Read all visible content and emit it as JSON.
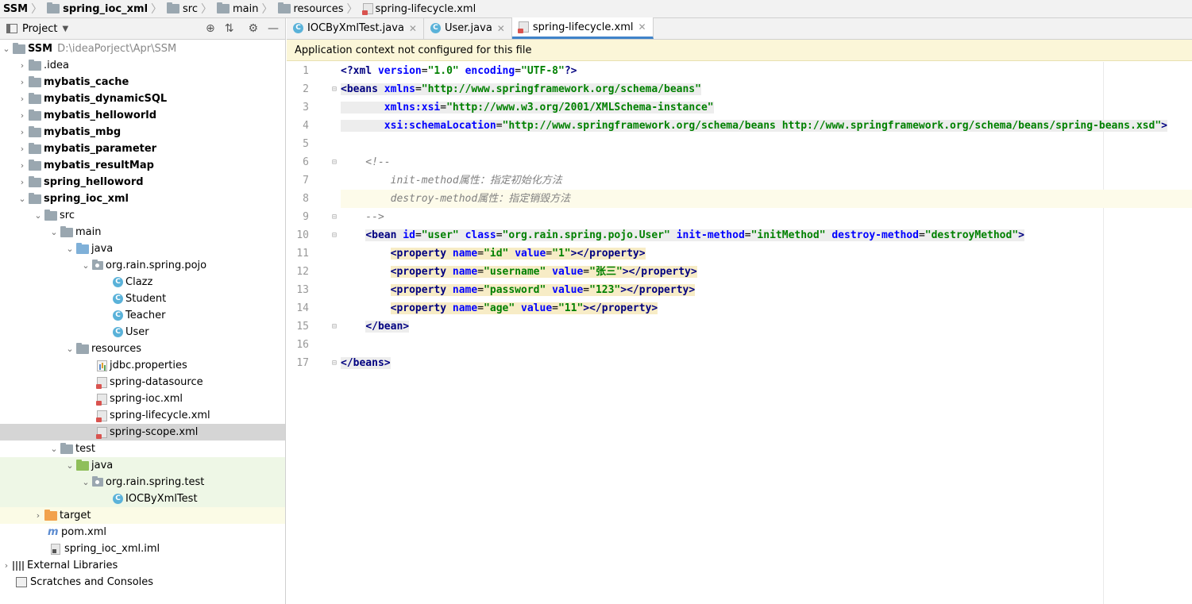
{
  "breadcrumb": [
    "SSM",
    "spring_ioc_xml",
    "src",
    "main",
    "resources",
    "spring-lifecycle.xml"
  ],
  "project_panel": {
    "title": "Project",
    "tree": [
      {
        "label": "SSM",
        "extra": "D:\\ideaPorject\\Apr\\SSM"
      },
      {
        "label": ".idea"
      },
      {
        "label": "mybatis_cache"
      },
      {
        "label": "mybatis_dynamicSQL"
      },
      {
        "label": "mybatis_helloworld"
      },
      {
        "label": "mybatis_mbg"
      },
      {
        "label": "mybatis_parameter"
      },
      {
        "label": "mybatis_resultMap"
      },
      {
        "label": "spring_helloword"
      },
      {
        "label": "spring_ioc_xml"
      },
      {
        "label": "src"
      },
      {
        "label": "main"
      },
      {
        "label": "java"
      },
      {
        "label": "org.rain.spring.pojo"
      },
      {
        "label": "Clazz"
      },
      {
        "label": "Student"
      },
      {
        "label": "Teacher"
      },
      {
        "label": "User"
      },
      {
        "label": "resources"
      },
      {
        "label": "jdbc.properties"
      },
      {
        "label": "spring-datasource"
      },
      {
        "label": "spring-ioc.xml"
      },
      {
        "label": "spring-lifecycle.xml"
      },
      {
        "label": "spring-scope.xml"
      },
      {
        "label": "test"
      },
      {
        "label": "java"
      },
      {
        "label": "org.rain.spring.test"
      },
      {
        "label": "IOCByXmlTest"
      },
      {
        "label": "target"
      },
      {
        "label": "pom.xml"
      },
      {
        "label": "spring_ioc_xml.iml"
      },
      {
        "label": "External Libraries"
      },
      {
        "label": "Scratches and Consoles"
      }
    ]
  },
  "tabs": [
    "IOCByXmlTest.java",
    "User.java",
    "spring-lifecycle.xml"
  ],
  "banner": "Application context not configured for this file",
  "line_numbers": [
    "1",
    "2",
    "3",
    "4",
    "5",
    "6",
    "7",
    "8",
    "9",
    "10",
    "11",
    "12",
    "13",
    "14",
    "15",
    "16",
    "17"
  ],
  "code": {
    "l1": [
      "<?",
      "xml ",
      "version",
      "=",
      "\"1.0\"",
      " ",
      "encoding",
      "=",
      "\"UTF-8\"",
      "?>"
    ],
    "l2": [
      "<beans ",
      "xmlns",
      "=",
      "\"http://www.springframework.org/schema/beans\""
    ],
    "l3": [
      "       ",
      "xmlns:xsi",
      "=",
      "\"http://www.w3.org/2001/XMLSchema-instance\""
    ],
    "l4": [
      "       ",
      "xsi:schemaLocation",
      "=",
      "\"http://www.springframework.org/schema/beans http://www.springframework.org/schema/beans/spring-beans.xsd\"",
      ">"
    ],
    "l6": "    <!--",
    "l7": "        init-method属性：指定初始化方法",
    "l8": "        destroy-method属性：指定销毁方法",
    "l9": "    -->",
    "l10": [
      "<bean ",
      "id",
      "=",
      "\"user\"",
      " ",
      "class",
      "=",
      "\"org.rain.spring.pojo.User\"",
      " ",
      "init-method",
      "=",
      "\"initMethod\"",
      " ",
      "destroy-method",
      "=",
      "\"destroyMethod\"",
      ">"
    ],
    "l11": [
      "<property ",
      "name",
      "=",
      "\"id\"",
      " ",
      "value",
      "=",
      "\"1\"",
      "></property>"
    ],
    "l12": [
      "<property ",
      "name",
      "=",
      "\"username\"",
      " ",
      "value",
      "=",
      "\"张三\"",
      "></property>"
    ],
    "l13": [
      "<property ",
      "name",
      "=",
      "\"password\"",
      " ",
      "value",
      "=",
      "\"123\"",
      "></property>"
    ],
    "l14": [
      "<property ",
      "name",
      "=",
      "\"age\"",
      " ",
      "value",
      "=",
      "\"11\"",
      "></property>"
    ],
    "l15": "</bean>",
    "l17": "</beans>"
  },
  "icons": {
    "locate": "crosshair-icon",
    "collapse": "collapse-all-icon",
    "settings": "gear-icon",
    "hide": "minimize-icon",
    "intention": "lightbulb-icon"
  }
}
